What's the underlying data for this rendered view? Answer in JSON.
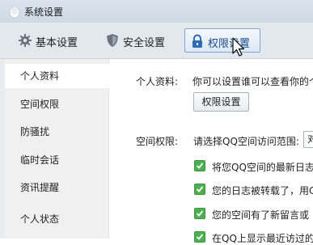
{
  "window": {
    "title": "系统设置"
  },
  "tabs": [
    {
      "label": "基本设置",
      "icon": "gear-icon"
    },
    {
      "label": "安全设置",
      "icon": "shield-icon"
    },
    {
      "label": "权限设置",
      "icon": "lock-icon",
      "active": true
    }
  ],
  "sidebar": {
    "items": [
      {
        "label": "个人资料",
        "active": true
      },
      {
        "label": "空间权限"
      },
      {
        "label": "防骚扰"
      },
      {
        "label": "临时会话"
      },
      {
        "label": "资讯提醒"
      },
      {
        "label": "个人状态"
      }
    ]
  },
  "main": {
    "profile": {
      "label": "个人资料:",
      "description": "你可以设置谁可以查看你的个",
      "button_label": "权限设置"
    },
    "space": {
      "label": "空间权限:",
      "prompt": "请选择QQ空间访问范围:",
      "select_value": "对",
      "checkboxes": [
        {
          "label": "将您QQ空间的最新日志",
          "checked": true
        },
        {
          "label": "您的日志被转载了，用C",
          "checked": true
        },
        {
          "label": "您的空间有了新留言或",
          "checked": true
        },
        {
          "label": "在QQ上显示最近访过的",
          "checked": true
        }
      ]
    }
  },
  "colors": {
    "checkbox": "#4caf50",
    "active_tab_border": "#7ea6d6",
    "sidebar_bg": "#f0f0f0"
  }
}
